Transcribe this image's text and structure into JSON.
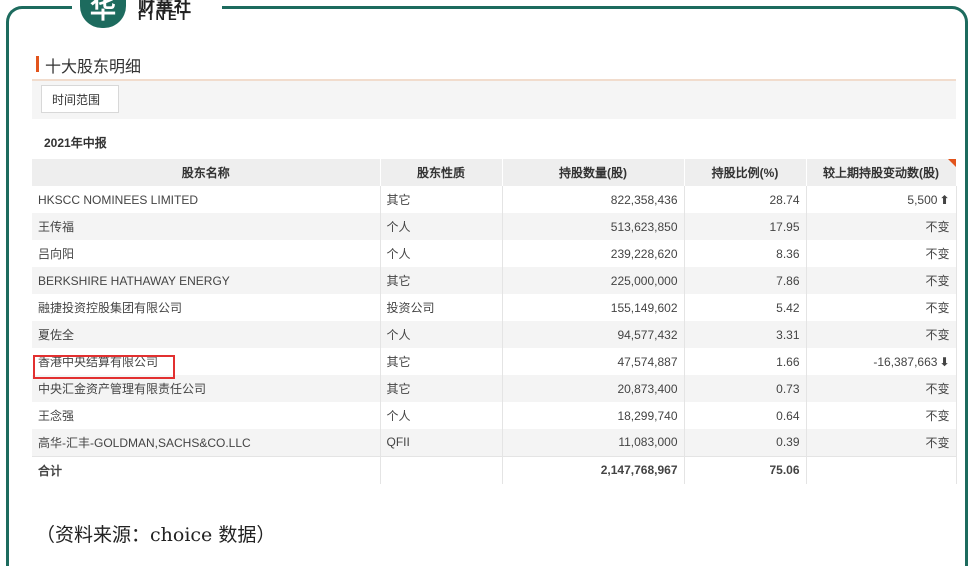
{
  "logo": {
    "glyph": "华",
    "cn": "财華社",
    "en": "FINET"
  },
  "panel": {
    "title": "十大股东明细",
    "range_button": "时间范围",
    "period": "2021年中报"
  },
  "table": {
    "headers": [
      "股东名称",
      "股东性质",
      "持股数量(股)",
      "持股比例(%)",
      "较上期持股变动数(股)"
    ],
    "rows": [
      {
        "name": "HKSCC NOMINEES LIMITED",
        "type": "其它",
        "shares": "822,358,436",
        "ratio": "28.74",
        "change": "5,500",
        "dir": "up"
      },
      {
        "name": "王传福",
        "type": "个人",
        "shares": "513,623,850",
        "ratio": "17.95",
        "change": "不变",
        "dir": "none"
      },
      {
        "name": "吕向阳",
        "type": "个人",
        "shares": "239,228,620",
        "ratio": "8.36",
        "change": "不变",
        "dir": "none"
      },
      {
        "name": "BERKSHIRE HATHAWAY ENERGY",
        "type": "其它",
        "shares": "225,000,000",
        "ratio": "7.86",
        "change": "不变",
        "dir": "none"
      },
      {
        "name": "融捷投资控股集团有限公司",
        "type": "投资公司",
        "shares": "155,149,602",
        "ratio": "5.42",
        "change": "不变",
        "dir": "none"
      },
      {
        "name": "夏佐全",
        "type": "个人",
        "shares": "94,577,432",
        "ratio": "3.31",
        "change": "不变",
        "dir": "none"
      },
      {
        "name": "香港中央结算有限公司",
        "type": "其它",
        "shares": "47,574,887",
        "ratio": "1.66",
        "change": "-16,387,663",
        "dir": "down"
      },
      {
        "name": "中央汇金资产管理有限责任公司",
        "type": "其它",
        "shares": "20,873,400",
        "ratio": "0.73",
        "change": "不变",
        "dir": "none"
      },
      {
        "name": "王念强",
        "type": "个人",
        "shares": "18,299,740",
        "ratio": "0.64",
        "change": "不变",
        "dir": "none"
      },
      {
        "name": "高华-汇丰-GOLDMAN,SACHS&CO.LLC",
        "type": "QFII",
        "shares": "11,083,000",
        "ratio": "0.39",
        "change": "不变",
        "dir": "none"
      }
    ],
    "total": {
      "label": "合计",
      "shares": "2,147,768,967",
      "ratio": "75.06"
    }
  },
  "source": "（资料来源：choice 数据）",
  "colors": {
    "frame": "#1d6b5e",
    "accent": "#e2541c",
    "up": "#d61f1f",
    "down": "#3a9a3a",
    "highlight": "#e23030"
  },
  "icons": {
    "up": "arrow-up-icon",
    "down": "arrow-down-icon"
  }
}
